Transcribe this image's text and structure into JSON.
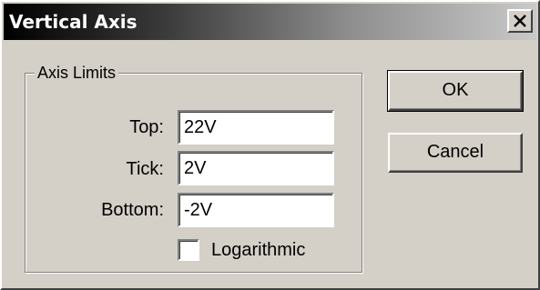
{
  "window": {
    "title": "Vertical Axis"
  },
  "titlebar": {
    "close_icon": "close-x-icon"
  },
  "axis_limits": {
    "group_label": "Axis Limits",
    "top": {
      "label": "Top:",
      "value": "22V"
    },
    "tick": {
      "label": "Tick:",
      "value": "2V"
    },
    "bottom": {
      "label": "Bottom:",
      "value": "-2V"
    },
    "logarithmic": {
      "label": "Logarithmic",
      "checked": false
    }
  },
  "buttons": {
    "ok_label": "OK",
    "cancel_label": "Cancel"
  },
  "colors": {
    "face": "#d4d0c8",
    "title_gradient_start": "#000000",
    "title_gradient_end": "#c9c9c9",
    "title_text": "#ffffff"
  }
}
